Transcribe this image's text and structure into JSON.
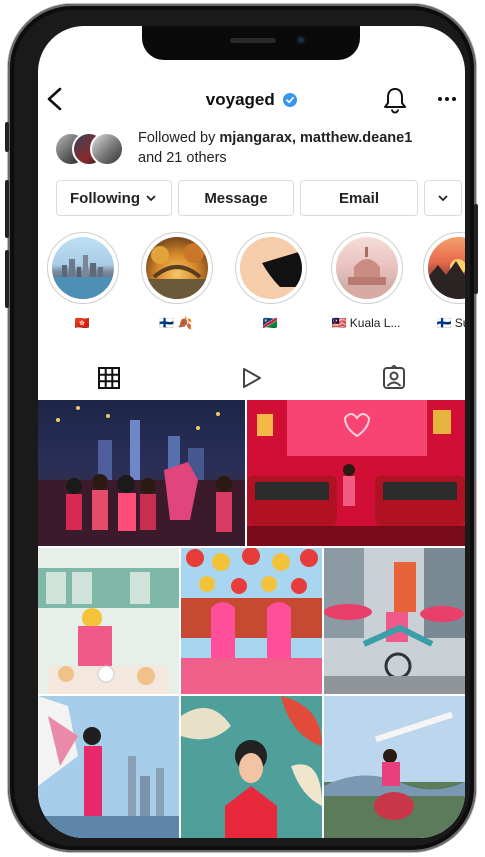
{
  "profile": {
    "username": "voyaged",
    "verified": true,
    "followed_by": {
      "prefix": "Followed by ",
      "names": "mjangarax, matthew.deane1",
      "suffix_line": "and 21 others"
    }
  },
  "actions": {
    "following_label": "Following",
    "message_label": "Message",
    "email_label": "Email"
  },
  "stories": [
    {
      "label": "🇭🇰",
      "icon": "hong-kong-flag"
    },
    {
      "label": "🇫🇮 🍂",
      "icon": "finland-flag-leaves"
    },
    {
      "label": "🇳🇦",
      "icon": "namibia-flag"
    },
    {
      "label": "🇲🇾 Kuala L...",
      "icon": "malaysia-flag"
    },
    {
      "label": "🇫🇮 Sum",
      "icon": "finland-flag"
    }
  ],
  "tabs": [
    {
      "icon": "grid-icon",
      "active": true
    },
    {
      "icon": "reels-play-icon",
      "active": false
    },
    {
      "icon": "tagged-person-icon",
      "active": false
    }
  ],
  "colors": {
    "verified": "#3797f0",
    "border": "#dbdbdb",
    "text": "#222222"
  }
}
